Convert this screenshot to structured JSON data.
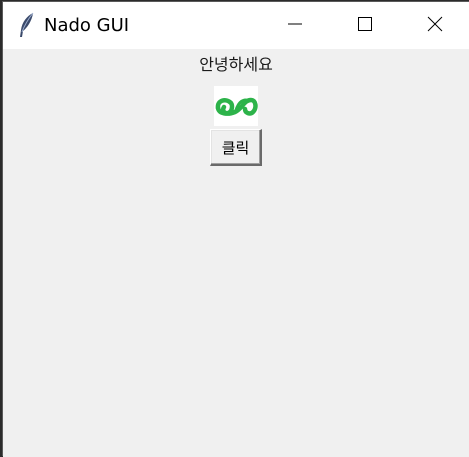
{
  "window": {
    "title": "Nado GUI",
    "icons": {
      "app": "feather-icon",
      "minimize": "minimize-icon",
      "maximize": "maximize-icon",
      "close": "close-icon"
    }
  },
  "content": {
    "label_text": "안녕하세요",
    "image_icon": "green-chain-logo",
    "button_label": "클릭"
  },
  "colors": {
    "background": "#f0f0f0",
    "titlebar": "#ffffff",
    "logo_green": "#2db34a"
  }
}
